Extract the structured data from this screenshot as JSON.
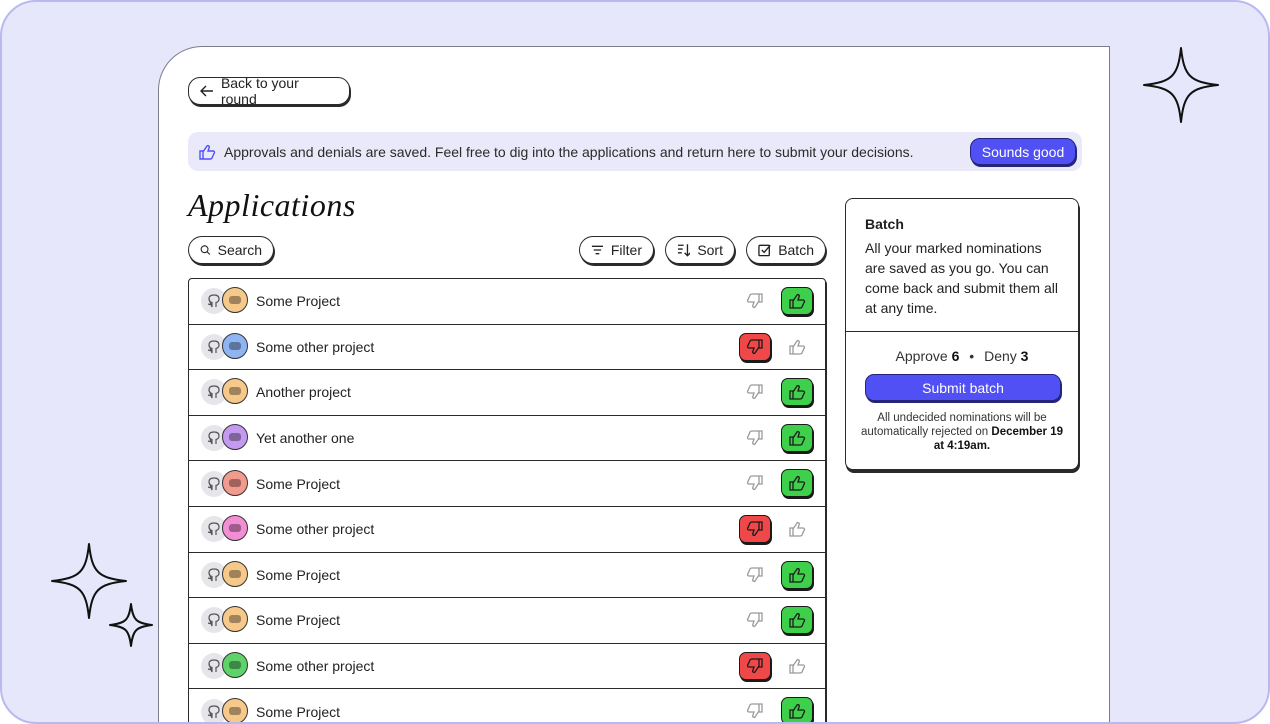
{
  "nav": {
    "back_label": "Back to your round"
  },
  "banner": {
    "text": "Approvals and denials are saved. Feel free to dig into the applications and return here to submit your decisions.",
    "button_label": "Sounds good"
  },
  "page": {
    "title": "Applications"
  },
  "toolbar": {
    "search_label": "Search",
    "filter_label": "Filter",
    "sort_label": "Sort",
    "batch_label": "Batch"
  },
  "applications": [
    {
      "name": "Some Project",
      "avatar_color": "#f6c98a",
      "decision": "approved"
    },
    {
      "name": "Some other project",
      "avatar_color": "#8fb4f2",
      "decision": "denied"
    },
    {
      "name": "Another project",
      "avatar_color": "#f6c98a",
      "decision": "approved"
    },
    {
      "name": "Yet another one",
      "avatar_color": "#c49af0",
      "decision": "approved"
    },
    {
      "name": "Some Project",
      "avatar_color": "#f39a8e",
      "decision": "approved"
    },
    {
      "name": "Some other project",
      "avatar_color": "#f28ed3",
      "decision": "denied"
    },
    {
      "name": "Some Project",
      "avatar_color": "#f6c98a",
      "decision": "approved"
    },
    {
      "name": "Some Project",
      "avatar_color": "#f6c98a",
      "decision": "approved"
    },
    {
      "name": "Some other project",
      "avatar_color": "#5fd26a",
      "decision": "denied"
    },
    {
      "name": "Some Project",
      "avatar_color": "#f6c98a",
      "decision": "approved"
    }
  ],
  "batch_panel": {
    "heading": "Batch",
    "body": "All your marked nominations are saved as you go. You can come back and submit them all at any time.",
    "approve_label": "Approve",
    "approve_count": "6",
    "deny_label": "Deny",
    "deny_count": "3",
    "separator": "•",
    "submit_label": "Submit batch",
    "note_text": "All undecided nominations will be automatically rejected on",
    "note_date": "December 19 at 4:19am."
  },
  "colors": {
    "background": "#e7e7fb",
    "accent": "#5050f5",
    "approve": "#3ed04a",
    "deny": "#f04848"
  }
}
